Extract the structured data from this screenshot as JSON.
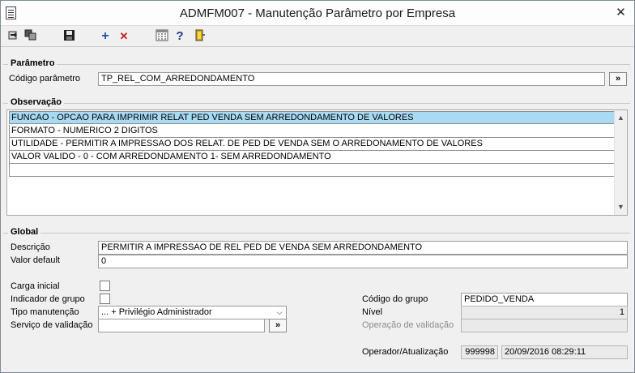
{
  "window": {
    "title": "ADMFM007 - Manutenção Parâmetro por Empresa",
    "close_glyph": "✕"
  },
  "toolbar": {
    "icons": [
      "move-right-icon",
      "copy-icon",
      "save-icon",
      "add-icon",
      "delete-icon",
      "calculator-icon",
      "help-icon",
      "exit-door-icon"
    ],
    "add_glyph": "+",
    "delete_glyph": "✕",
    "help_glyph": "?"
  },
  "parametro": {
    "group_title": "Parâmetro",
    "codigo_label": "Código parâmetro",
    "codigo_value": "TP_REL_COM_ARREDONDAMENTO",
    "lookup_label": "»"
  },
  "observacao": {
    "group_title": "Observação",
    "lines": [
      "FUNCAO - OPCAO PARA IMPRIMIR RELAT  PED VENDA SEM ARREDONDAMENTO DE VALORES",
      "FORMATO - NUMERICO 2 DIGITOS",
      "UTILIDADE - PERMITIR A IMPRESSAO DOS RELAT. DE PED DE VENDA SEM O ARREDONAMENTO DE VALORES",
      "VALOR VALIDO -    0 - COM ARREDONDAMENTO     1- SEM ARREDONDAMENTO",
      ""
    ]
  },
  "global": {
    "group_title": "Global",
    "descricao_label": "Descrição",
    "descricao_value": "PERMITIR A IMPRESSAO DE REL PED DE VENDA SEM ARREDONDAMENTO",
    "valor_default_label": "Valor default",
    "valor_default_value": "0",
    "carga_inicial_label": "Carga inicial",
    "indicador_grupo_label": "Indicador de grupo",
    "tipo_manutencao_label": "Tipo manutenção",
    "tipo_manutencao_value": "... + Privilégio Administrador",
    "servico_validacao_label": "Serviço de validação",
    "servico_validacao_value": "",
    "servico_lookup_label": "»",
    "codigo_grupo_label": "Código do grupo",
    "codigo_grupo_value": "PEDIDO_VENDA",
    "nivel_label": "Nível",
    "nivel_value": "1",
    "operacao_validacao_label": "Operação de validação",
    "operacao_validacao_value": "",
    "operador_label": "Operador/Atualização",
    "operador_value": "999998",
    "atualizacao_value": "20/09/2016 08:29:11"
  }
}
